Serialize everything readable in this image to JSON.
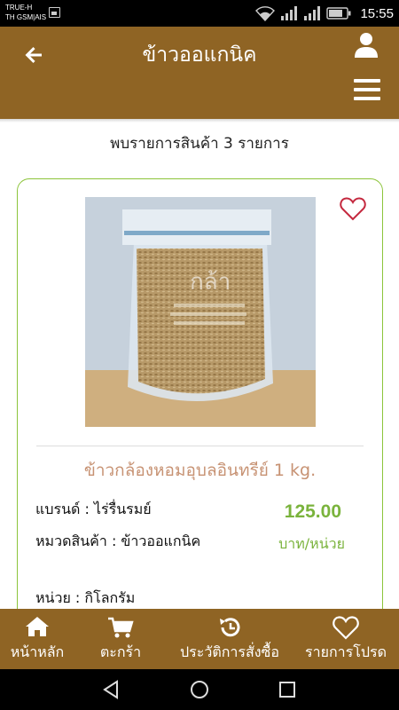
{
  "status_bar": {
    "carrier_line1": "TRUE-H",
    "carrier_line2": "TH GSM|AIS",
    "time": "15:55"
  },
  "header": {
    "title": "ข้าวออแกนิค",
    "back_icon": "arrow-left-icon",
    "user_icon": "user-icon",
    "menu_icon": "hamburger-menu-icon"
  },
  "results": {
    "summary": "พบรายการสินค้า 3 รายการ"
  },
  "products": [
    {
      "name": "ข้าวกล้องหอมอุบลอินทรีย์ 1 kg.",
      "brand": "แบรนด์ : ไร่รื่นรมย์",
      "category": "หมวดสินค้า : ข้าวออแกนิค",
      "unit": "หน่วย : กิโลกรัม",
      "price": "125.00",
      "price_unit": "บาท/หน่วย",
      "favorite_icon": "heart-outline-icon"
    }
  ],
  "bottom_nav": [
    {
      "label": "หน้าหลัก",
      "icon": "home-icon"
    },
    {
      "label": "ตะกร้า",
      "icon": "cart-icon"
    },
    {
      "label": "ประวัติการสั่งซื้อ",
      "icon": "history-icon"
    },
    {
      "label": "รายการโปรด",
      "icon": "heart-outline-icon"
    }
  ],
  "colors": {
    "brand_brown": "#8f6424",
    "accent_green": "#7ab33c",
    "card_border": "#8cc43a",
    "product_name": "#c79273",
    "heart": "#c4293f"
  }
}
